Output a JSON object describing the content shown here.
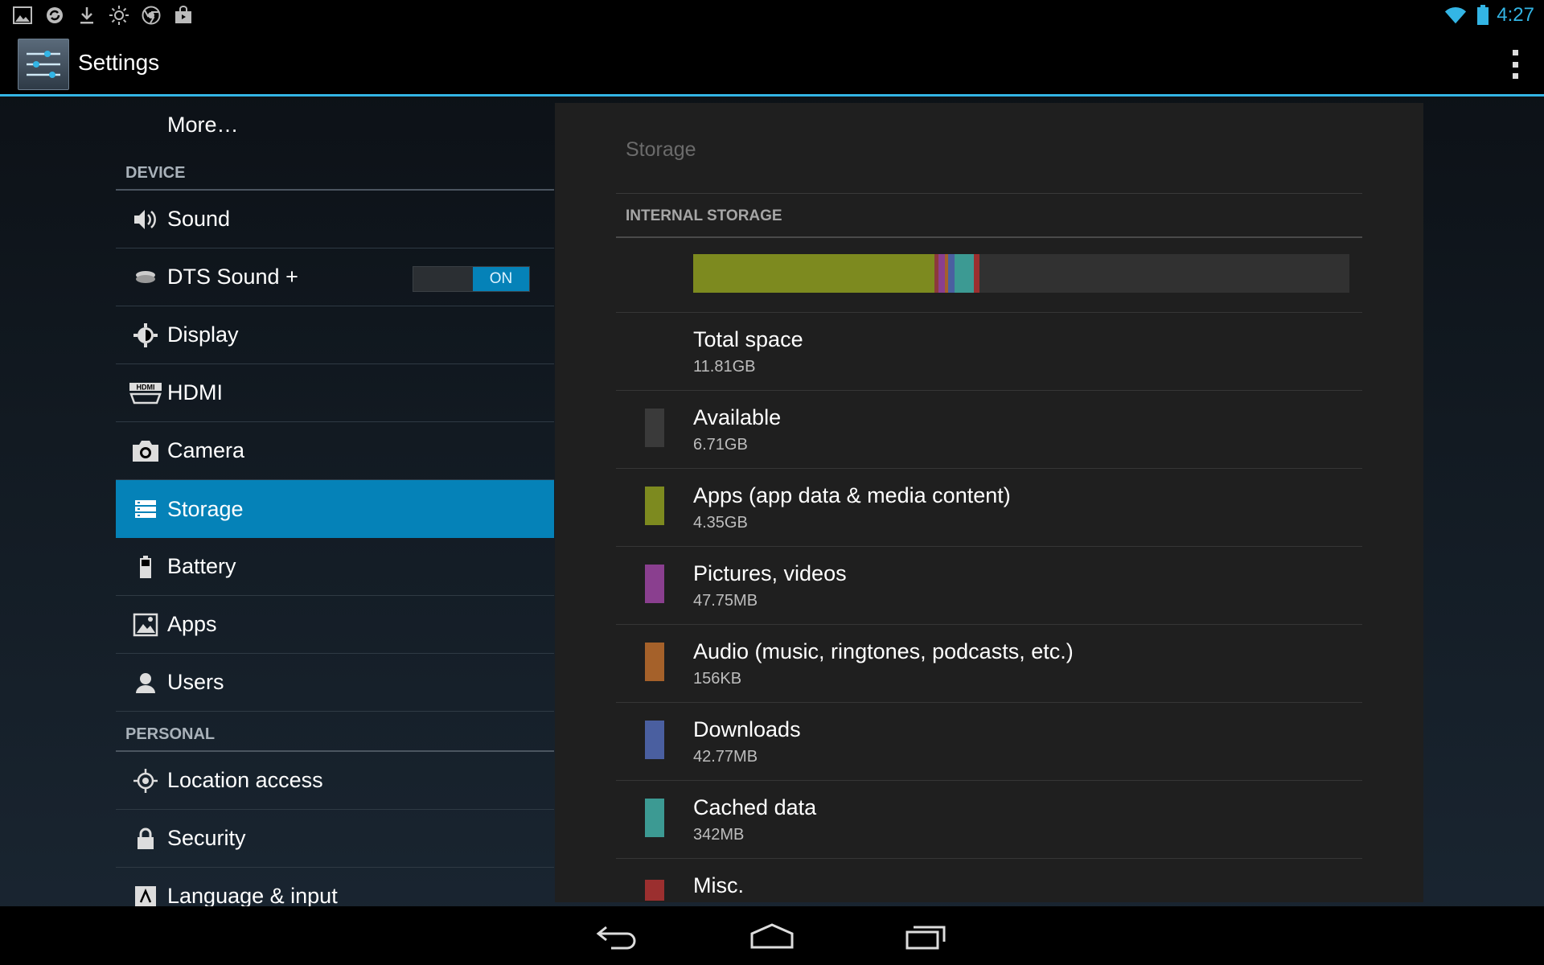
{
  "status_bar": {
    "time": "4:27",
    "left_icons": [
      "gallery-icon",
      "sync-icon",
      "download-icon",
      "brightness-icon",
      "chrome-icon",
      "shop-icon"
    ],
    "right_icons": [
      "wifi-icon",
      "battery-icon"
    ]
  },
  "action_bar": {
    "title": "Settings",
    "app_icon": "settings-app-icon",
    "overflow_icon": "overflow-menu-icon"
  },
  "sidebar": {
    "more_item": "More…",
    "device_header": "DEVICE",
    "device_items": [
      {
        "label": "Sound",
        "icon": "speaker-icon"
      },
      {
        "label": "DTS Sound +",
        "icon": "dts-icon",
        "toggle": "ON"
      },
      {
        "label": "Display",
        "icon": "display-gear-icon"
      },
      {
        "label": "HDMI",
        "icon": "hdmi-icon"
      },
      {
        "label": "Camera",
        "icon": "camera-icon"
      },
      {
        "label": "Storage",
        "icon": "storage-icon",
        "selected": true
      },
      {
        "label": "Battery",
        "icon": "battery-icon"
      },
      {
        "label": "Apps",
        "icon": "apps-icon"
      },
      {
        "label": "Users",
        "icon": "users-icon"
      }
    ],
    "personal_header": "PERSONAL",
    "personal_items": [
      {
        "label": "Location access",
        "icon": "location-icon"
      },
      {
        "label": "Security",
        "icon": "lock-icon"
      },
      {
        "label": "Language & input",
        "icon": "language-icon"
      }
    ]
  },
  "storage": {
    "title": "Storage",
    "section": "INTERNAL STORAGE",
    "usage_bar_segments": [
      {
        "name": "Apps",
        "fraction": 0.368,
        "color": "#7d8a1f"
      },
      {
        "name": "Misc-1",
        "fraction": 0.006,
        "color": "#8c3a3a"
      },
      {
        "name": "Pictures, videos",
        "fraction": 0.01,
        "color": "#8a3f8f"
      },
      {
        "name": "Audio",
        "fraction": 0.004,
        "color": "#a5612a"
      },
      {
        "name": "Downloads",
        "fraction": 0.01,
        "color": "#4a5fa0"
      },
      {
        "name": "Cached data",
        "fraction": 0.03,
        "color": "#3c9a93"
      },
      {
        "name": "Misc",
        "fraction": 0.008,
        "color": "#9b2f2f"
      }
    ],
    "rows": [
      {
        "label": "Total space",
        "value": "11.81GB",
        "color": ""
      },
      {
        "label": "Available",
        "value": "6.71GB",
        "color": "#3a3a3a"
      },
      {
        "label": "Apps (app data & media content)",
        "value": "4.35GB",
        "color": "#7d8a1f"
      },
      {
        "label": "Pictures, videos",
        "value": "47.75MB",
        "color": "#8a3f8f"
      },
      {
        "label": "Audio (music, ringtones, podcasts, etc.)",
        "value": "156KB",
        "color": "#a5612a"
      },
      {
        "label": "Downloads",
        "value": "42.77MB",
        "color": "#4a5fa0"
      },
      {
        "label": "Cached data",
        "value": "342MB",
        "color": "#3c9a93"
      },
      {
        "label": "Misc.",
        "value": "",
        "color": "#9b2f2f"
      }
    ]
  },
  "nav_bar": {
    "buttons": [
      "back-icon",
      "home-icon",
      "recents-icon"
    ]
  }
}
